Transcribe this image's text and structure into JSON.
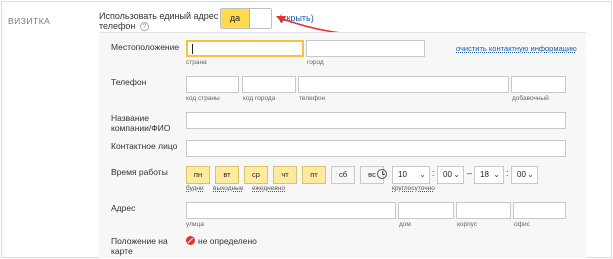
{
  "section": {
    "title": "ВИЗИТКА"
  },
  "option": {
    "label": "Использовать единый адрес и телефон",
    "help_icon": "question-circle-icon",
    "toggle_on": "да",
    "hide_link": "(скрыть)"
  },
  "annotation": {
    "arrow_color": "#e0342f"
  },
  "location": {
    "label": "Местоположение",
    "country_sub": "страна",
    "city_sub": "город",
    "clear_link": "очистить контактную информацию"
  },
  "phone": {
    "label": "Телефон",
    "country_code_sub": "код страны",
    "city_code_sub": "код города",
    "number_sub": "телефон",
    "ext_sub": "добавочный"
  },
  "company": {
    "label": "Название компании/ФИО"
  },
  "contact": {
    "label": "Контактное лицо"
  },
  "hours": {
    "label": "Время работы",
    "days": [
      {
        "label": "пн",
        "selected": true
      },
      {
        "label": "вт",
        "selected": true
      },
      {
        "label": "ср",
        "selected": true
      },
      {
        "label": "чт",
        "selected": true
      },
      {
        "label": "пт",
        "selected": true
      },
      {
        "label": "сб",
        "selected": false
      },
      {
        "label": "вс",
        "selected": false
      }
    ],
    "link_weekdays": "будни",
    "link_weekends": "выходные",
    "link_daily": "ежедневно",
    "clock_icon": "clock-icon",
    "from_hour": "10",
    "from_min": "00",
    "to_hour": "18",
    "to_min": "00",
    "sep": ":",
    "dash": "–",
    "around_clock": "круглосуточно"
  },
  "address": {
    "label": "Адрес",
    "street_sub": "улица",
    "house_sub": "дом",
    "building_sub": "корпус",
    "office_sub": "офис"
  },
  "map": {
    "label": "Положение на карте",
    "status_icon": "error-circle-icon",
    "status": "не определено"
  },
  "colors": {
    "accent": "#ffdb4d",
    "link": "#1a5dad",
    "day_selected": "#ffeba0"
  }
}
